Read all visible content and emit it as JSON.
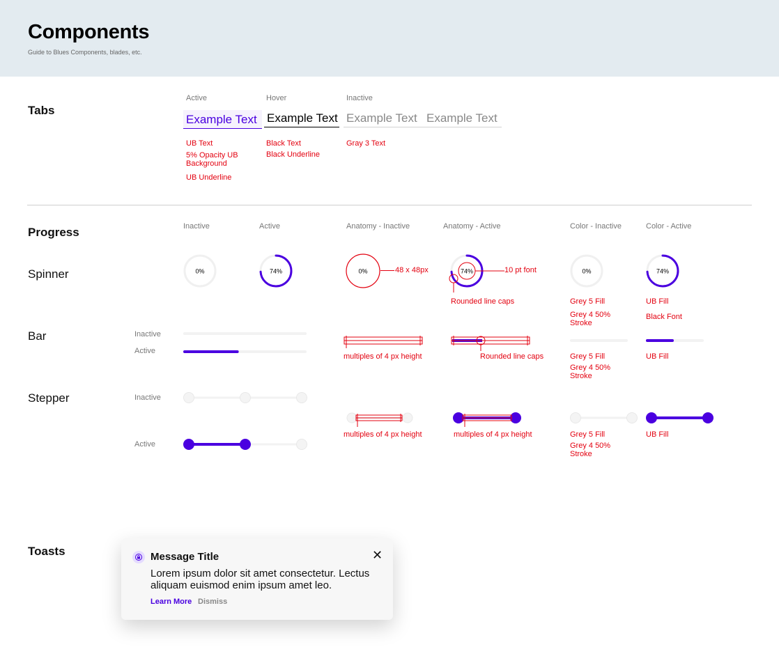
{
  "header": {
    "title": "Components",
    "subtitle": "Guide to Blues Components, blades, etc."
  },
  "tabs_section": {
    "title": "Tabs",
    "labels": {
      "active": "Active",
      "hover": "Hover",
      "inactive": "Inactive"
    },
    "tabs": [
      "Example Text",
      "Example Text",
      "Example Text",
      "Example Text"
    ],
    "notes": {
      "active": [
        "UB Text",
        "5% Opacity UB Background",
        "UB Underline"
      ],
      "hover": [
        "Black Text",
        "Black Underline"
      ],
      "inactive": [
        "Gray 3 Text"
      ]
    }
  },
  "progress_section": {
    "title": "Progress",
    "columns": {
      "inactive": "Inactive",
      "active": "Active",
      "anatomy_inactive": "Anatomy - Inactive",
      "anatomy_active": "Anatomy - Active",
      "color_inactive": "Color - Inactive",
      "color_active": "Color - Active"
    },
    "spinner": {
      "title": "Spinner",
      "inactive_value": "0%",
      "active_value": "74%",
      "active_fraction": 0.74,
      "anatomy_size_note": "48 x 48px",
      "anatomy_font_note": "10 pt font",
      "anatomy_caps_note": "Rounded line caps",
      "color_inactive_notes": [
        "Grey 5 Fill",
        "Grey 4 50% Stroke"
      ],
      "color_active_notes": [
        "UB Fill",
        "Black Font"
      ]
    },
    "bar": {
      "title": "Bar",
      "state_inactive": "Inactive",
      "state_active": "Active",
      "active_fraction": 0.45,
      "anatomy_height_note": "multiples of 4 px height",
      "anatomy_caps_note": "Rounded line caps",
      "color_inactive_notes": [
        "Grey 5 Fill",
        "Grey 4 50% Stroke"
      ],
      "color_active_notes": [
        "UB Fill"
      ]
    },
    "stepper": {
      "title": "Stepper",
      "state_inactive": "Inactive",
      "state_active": "Active",
      "anatomy_height_note": "multiples of 4 px height",
      "anatomy_active_height_note": "multiples of 4 px height",
      "color_inactive_notes": [
        "Grey 5 Fill",
        "Grey 4 50% Stroke"
      ],
      "color_active_notes": [
        "UB Fill"
      ]
    }
  },
  "toasts_section": {
    "title": "Toasts",
    "toast": {
      "icon": "lock-icon",
      "title": "Message Title",
      "body": "Lorem ipsum dolor sit amet consectetur. Lectus aliquam euismod enim ipsum amet leo.",
      "primary_action": "Learn More",
      "secondary_action": "Dismiss",
      "close_icon": "close-icon"
    }
  },
  "colors": {
    "ub": "#4a00e0",
    "annotation": "#e3000f",
    "grey5": "#f2f2f2",
    "grey4": "#e4e4e4",
    "header_bg": "#e3ebf0"
  }
}
